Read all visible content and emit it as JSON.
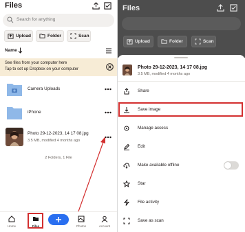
{
  "left": {
    "title": "Files",
    "search_placeholder": "Search for anything",
    "chips": [
      "Upload",
      "Folder",
      "Scan"
    ],
    "sort_label": "Name",
    "banner": {
      "line1": "See files from your computer here",
      "line2": "Tap to set up Dropbox on your computer"
    },
    "items": [
      {
        "name": "Camera Uploads",
        "meta": ""
      },
      {
        "name": "iPhone",
        "meta": ""
      },
      {
        "name": "Photo 29-12-2023, 14 17 08.jpg",
        "meta": "3.5 MB, modified 4 months ago"
      }
    ],
    "count": "2 Folders, 1 File",
    "nav": [
      "Home",
      "Files",
      "",
      "Photos",
      "Account"
    ]
  },
  "right": {
    "title": "Files",
    "chips": [
      "Upload",
      "Folder",
      "Scan"
    ],
    "file_name": "Photo 29-12-2023, 14 17 08.jpg",
    "file_meta": "3.5 MB, modified 4 months ago",
    "actions": [
      "Share",
      "Save image",
      "Manage access",
      "Edit",
      "Make available offline",
      "Star",
      "File activity",
      "Save as scan"
    ]
  },
  "colors": {
    "accent": "#2a6ff0",
    "folder": "#8fb8e8",
    "highlight": "#d32f2f",
    "banner": "#f7ecd6"
  }
}
